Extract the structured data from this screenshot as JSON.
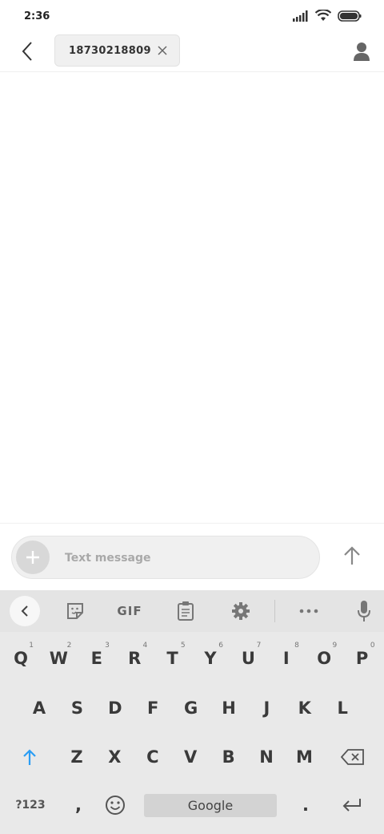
{
  "status_bar": {
    "time": "2:36"
  },
  "header": {
    "recipient": "18730218809"
  },
  "compose": {
    "placeholder": "Text message"
  },
  "keyboard": {
    "toolbar": {
      "gif_label": "GIF"
    },
    "rows": [
      [
        {
          "label": "Q",
          "hint": "1"
        },
        {
          "label": "W",
          "hint": "2"
        },
        {
          "label": "E",
          "hint": "3"
        },
        {
          "label": "R",
          "hint": "4"
        },
        {
          "label": "T",
          "hint": "5"
        },
        {
          "label": "Y",
          "hint": "6"
        },
        {
          "label": "U",
          "hint": "7"
        },
        {
          "label": "I",
          "hint": "8"
        },
        {
          "label": "O",
          "hint": "9"
        },
        {
          "label": "P",
          "hint": "0"
        }
      ],
      [
        {
          "label": "A"
        },
        {
          "label": "S"
        },
        {
          "label": "D"
        },
        {
          "label": "F"
        },
        {
          "label": "G"
        },
        {
          "label": "H"
        },
        {
          "label": "J"
        },
        {
          "label": "K"
        },
        {
          "label": "L"
        }
      ],
      [
        {
          "label": "Z"
        },
        {
          "label": "X"
        },
        {
          "label": "C"
        },
        {
          "label": "V"
        },
        {
          "label": "B"
        },
        {
          "label": "N"
        },
        {
          "label": "M"
        }
      ]
    ],
    "symbols_label": "?123",
    "comma_label": ",",
    "space_label": "Google",
    "period_label": "."
  },
  "colors": {
    "shift_accent": "#2a9df4",
    "keyboard_bg": "#e9e9e9"
  }
}
